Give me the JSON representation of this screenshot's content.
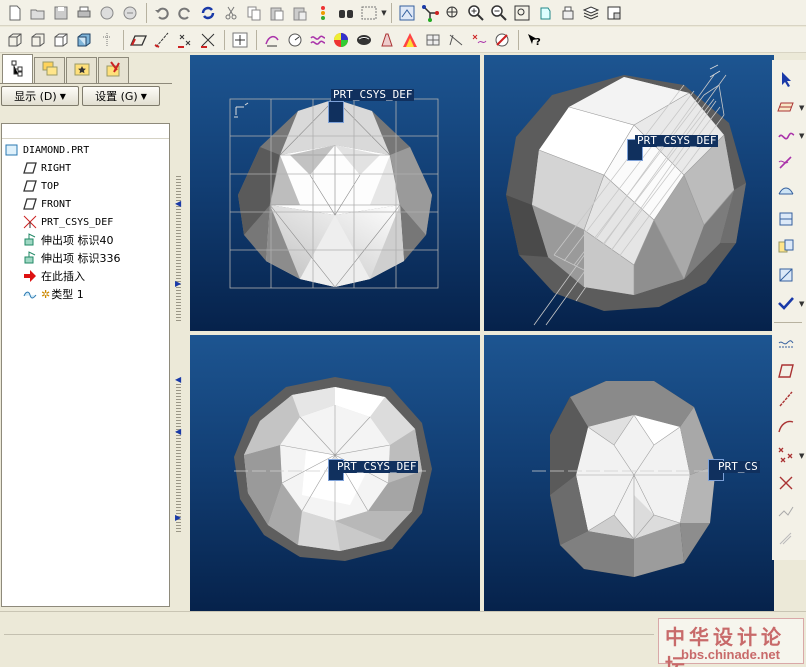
{
  "colors": {
    "viewport_top": "#1d5591",
    "viewport_bottom": "#06224b",
    "accent_blue": "#1a3aa8",
    "watermark": "#c86a6a"
  },
  "left_panel": {
    "tabs": [
      "model-tree-icon",
      "layer-tree-icon",
      "favorites-icon",
      "history-icon"
    ],
    "show_button": "显示 (D)",
    "settings_button": "设置 (G)"
  },
  "tree": {
    "items": [
      {
        "label": "DIAMOND.PRT",
        "icon": "part-icon"
      },
      {
        "label": "RIGHT",
        "icon": "datum-plane-icon"
      },
      {
        "label": "TOP",
        "icon": "datum-plane-icon"
      },
      {
        "label": "FRONT",
        "icon": "datum-plane-icon"
      },
      {
        "label": "PRT_CSYS_DEF",
        "icon": "csys-icon"
      },
      {
        "label": "伸出项 标识40",
        "icon": "extrude-icon"
      },
      {
        "label": "伸出项 标识336",
        "icon": "extrude-icon"
      },
      {
        "label": "在此插入",
        "icon": "insert-here-icon"
      },
      {
        "label": "类型 1",
        "icon": "pattern-icon"
      }
    ]
  },
  "viewports": {
    "csys_label": "PRT_CSYS_DEF",
    "csys_label_truncated": "PRT_CS"
  },
  "watermark": {
    "text": "中华设计论坛",
    "url": "bbs.chinade.net"
  }
}
